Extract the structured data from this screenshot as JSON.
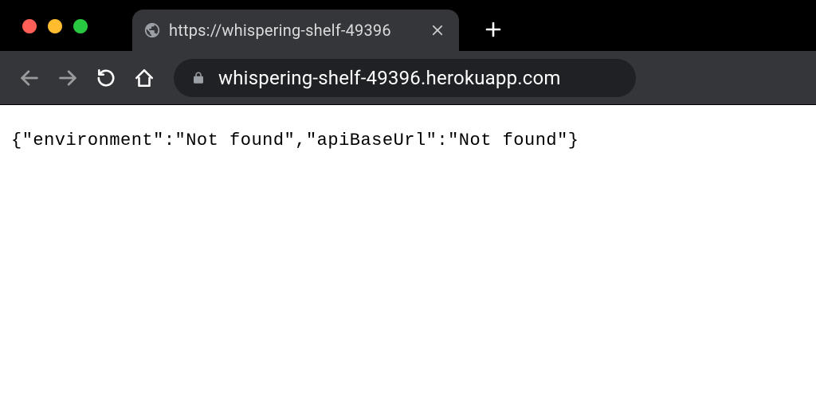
{
  "window": {
    "traffic_lights": {
      "close": "close",
      "minimize": "minimize",
      "maximize": "maximize"
    }
  },
  "tab": {
    "title": "https://whispering-shelf-49396",
    "favicon": "globe-icon"
  },
  "toolbar": {
    "url": "whispering-shelf-49396.herokuapp.com"
  },
  "page": {
    "body_text": "{\"environment\":\"Not found\",\"apiBaseUrl\":\"Not found\"}"
  }
}
